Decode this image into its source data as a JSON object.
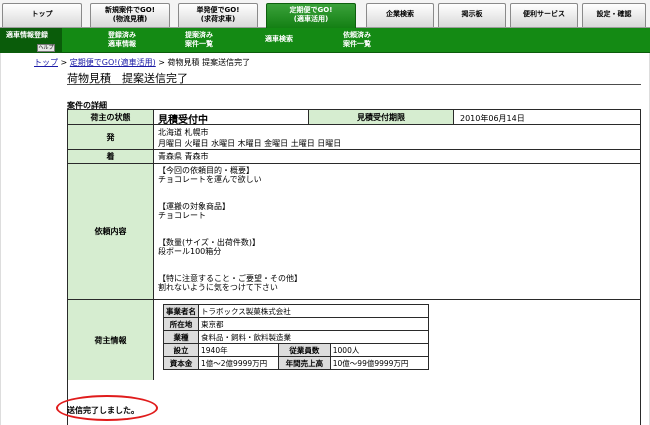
{
  "top_tabs": [
    {
      "label": "トップ",
      "active": false
    },
    {
      "label": "新規案件でGO!\n(物流見積)",
      "active": false
    },
    {
      "label": "単発便でGO!\n(求荷求車)",
      "active": false
    },
    {
      "label": "定期便でGO!\n(適車活用)",
      "active": true
    },
    {
      "label": "企業検索",
      "active": false
    },
    {
      "label": "掲示板",
      "active": false
    },
    {
      "label": "便利サービス",
      "active": false
    },
    {
      "label": "設定・確認",
      "active": false
    }
  ],
  "sub_nav": {
    "active": "適車情報登録",
    "help": "ヘルプ",
    "items": [
      "登録済み\n適車情報",
      "提案済み\n案件一覧",
      "適車検索",
      "依頼済み\n案件一覧"
    ]
  },
  "breadcrumb": {
    "home": "トップ",
    "sep": ">",
    "section": "定期便でGO!(適車活用)",
    "page": "荷物見積 提案送信完了"
  },
  "page_title": "荷物見積　提案送信完了",
  "section_label": "案件の詳細",
  "details": {
    "status_label": "荷主の状態",
    "status_value": "見積受付中",
    "deadline_label": "見積受付期限",
    "deadline_value": "2010年06月14日",
    "origin_label": "発",
    "origin_line1": "北海道 札幌市",
    "origin_line2": "月曜日 火曜日 水曜日 木曜日 金曜日 土曜日 日曜日",
    "dest_label": "着",
    "dest_value": "青森県 青森市",
    "request_label": "依頼内容",
    "request_lines": [
      "【今回の依頼目的・概要】",
      "チョコレートを運んで欲しい",
      "",
      "",
      "【運搬の対象商品】",
      "チョコレート",
      "",
      "",
      "【数量(サイズ・出荷件数)】",
      "段ボール100箱分",
      "",
      "",
      "【特に注意すること・ご要望・その他】",
      "割れないように気をつけて下さい"
    ],
    "shipper_label": "荷主情報",
    "shipper": {
      "company_label": "事業者名",
      "company_value": "トラボックス製菓株式会社",
      "location_label": "所在地",
      "location_value": "東京都",
      "industry_label": "業種",
      "industry_value": "食料品・飼料・飲料製造業",
      "founded_label": "設立",
      "founded_value": "1940年",
      "employees_label": "従業員数",
      "employees_value": "1000人",
      "capital_label": "資本金",
      "capital_value": "1億～2億9999万円",
      "sales_label": "年間売上高",
      "sales_value": "10億～99億9999万円"
    }
  },
  "completion_message": "送信完了しました。"
}
